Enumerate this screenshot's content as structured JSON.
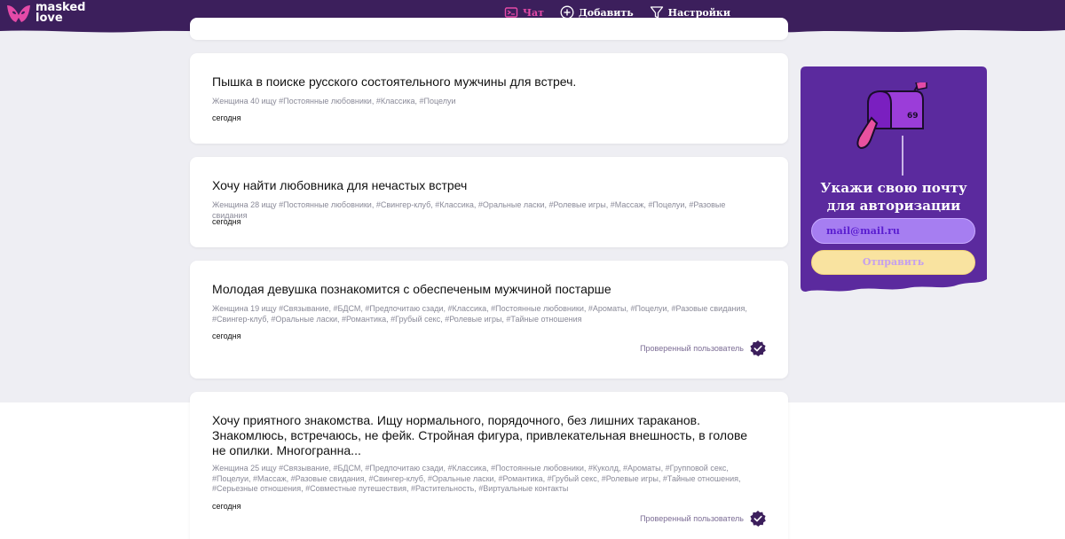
{
  "header": {
    "logo_line1": "masked",
    "logo_line2": "love",
    "nav": [
      {
        "label": "Чат",
        "icon": "chat-icon",
        "active": true
      },
      {
        "label": "Добавить",
        "icon": "plus-circle-icon",
        "active": false
      },
      {
        "label": "Настройки",
        "icon": "filter-icon",
        "active": false
      }
    ]
  },
  "posts": [
    {
      "title": "Пышка в поиске русского состоятельного мужчины для встреч.",
      "tags": "Женщина 40 ищу #Постоянные любовники, #Классика, #Поцелуи",
      "date": "сегодня"
    },
    {
      "title": "Хочу найти любовника для нечастых встреч",
      "tags": "Женщина 28 ищу #Постоянные любовники, #Свингер-клуб, #Классика, #Оральные ласки, #Ролевые игры, #Массаж, #Поцелуи, #Разовые свидания",
      "date": "сегодня"
    },
    {
      "title": "Молодая девушка познакомится с обеспеченым мужчиной постарше",
      "tags": "Женщина 19 ищу #Связывание, #БДСМ, #Предпочитаю сзади, #Классика, #Постоянные любовники, #Ароматы, #Поцелуи, #Разовые свидания, #Свингер-клуб, #Оральные ласки, #Романтика, #Грубый секс, #Ролевые игры, #Тайные отношения",
      "date": "сегодня",
      "verified": "Проверенный пользователь"
    },
    {
      "title": "Хочу приятного знакомства. Ищу нормального, порядочного, без лишних тараканов. Знакомлюсь, встречаюсь, не фейк. Стройная фигура, привлекательная внешность, в голове не опилки. Многогранна...",
      "tags": "Женщина 25 ищу #Связывание, #БДСМ, #Предпочитаю сзади, #Классика, #Постоянные любовники, #Куколд, #Ароматы, #Групповой секс, #Поцелуи, #Массаж, #Разовые свидания, #Свингер-клуб, #Оральные ласки, #Романтика, #Грубый секс, #Ролевые игры, #Тайные отношения, #Серьезные отношения, #Совместные путешествия, #Растительность, #Виртуальные контакты",
      "date": "сегодня",
      "verified": "Проверенный пользователь"
    }
  ],
  "sidebar": {
    "title_line1": "Укажи свою почту",
    "title_line2": "для авторизации",
    "email_placeholder": "mail@mail.ru",
    "submit_label": "Отправить",
    "mailbox_number": "69"
  },
  "colors": {
    "header_bg": "#3c1f5c",
    "accent_pink": "#e44aa7",
    "sidebar_bg": "#5b2a9e",
    "button_yellow": "#f9e3a0"
  }
}
